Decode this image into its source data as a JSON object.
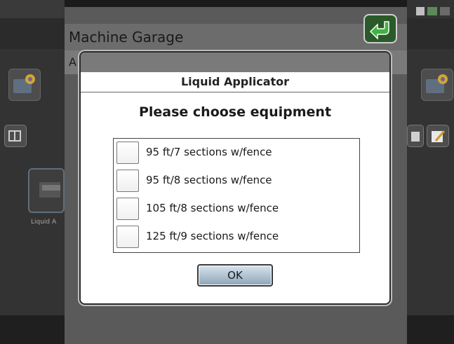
{
  "app": {
    "title": "Machine Garage",
    "available_label": "A"
  },
  "background": {
    "machine_tile_label": "Liquid A"
  },
  "icons": {
    "return": "return-arrow-icon",
    "settings": "gear-icon",
    "add": "add-icon",
    "delete": "trash-icon",
    "edit": "edit-icon",
    "machine": "sprayer-icon",
    "status": "status-icons"
  },
  "modal": {
    "title": "Liquid Applicator",
    "heading": "Please choose equipment",
    "options": [
      {
        "label": "95 ft/7 sections w/fence",
        "checked": false
      },
      {
        "label": "95 ft/8 sections w/fence",
        "checked": false
      },
      {
        "label": "105 ft/8 sections w/fence",
        "checked": false
      },
      {
        "label": "125 ft/9 sections w/fence",
        "checked": false
      }
    ],
    "ok_label": "OK"
  },
  "colors": {
    "accent_green": "#2a5a2a",
    "ok_button": "#a9bccb"
  }
}
